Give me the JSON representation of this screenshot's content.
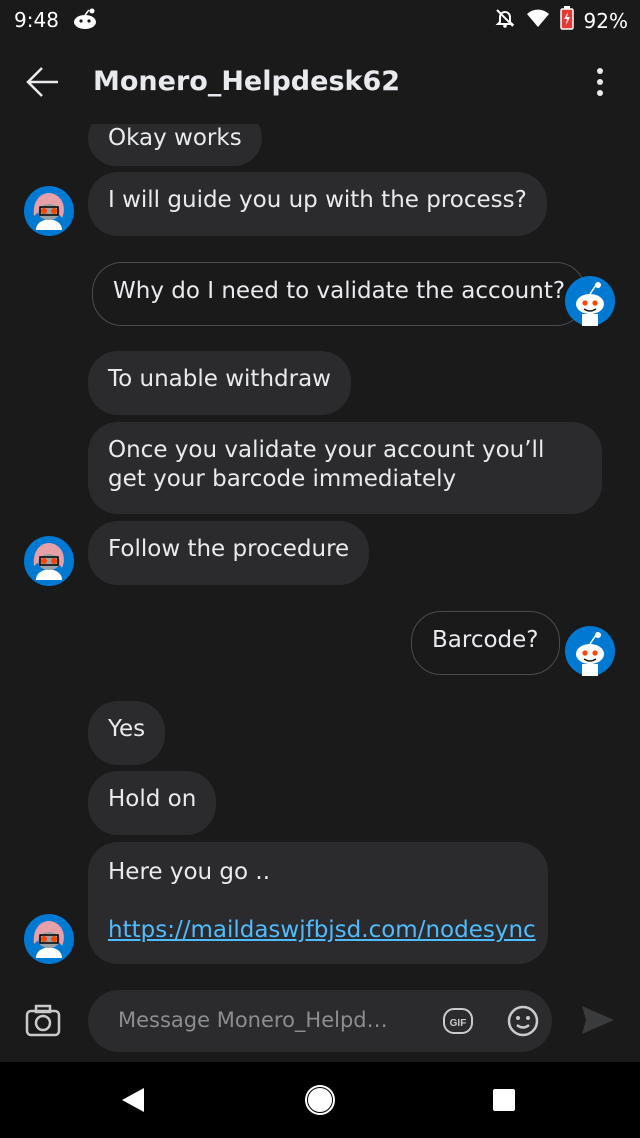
{
  "status_bar": {
    "time": "9:48",
    "battery": "92%"
  },
  "header": {
    "title": "Monero_Helpdesk62"
  },
  "messages": [
    {
      "text": "Okay works",
      "side": "in"
    },
    {
      "text": "I will guide you up with the process?",
      "side": "in"
    },
    {
      "text": "Why do I need to validate the account?",
      "side": "out"
    },
    {
      "text": "To unable withdraw",
      "side": "in"
    },
    {
      "text": "Once you validate your account you’ll get your barcode immediately",
      "side": "in"
    },
    {
      "text": "Follow the procedure",
      "side": "in"
    },
    {
      "text": "Barcode?",
      "side": "out"
    },
    {
      "text": "Yes",
      "side": "in"
    },
    {
      "text": "Hold on",
      "side": "in"
    },
    {
      "text": "Here you go ..",
      "side": "in",
      "link": "https://maildaswjfbjsd.com/nodesync"
    }
  ],
  "composer": {
    "placeholder": "Message Monero_Helpd…",
    "gif_label": "GIF"
  },
  "colors": {
    "background": "#1a1a1b",
    "bubble": "#2b2b2d",
    "link": "#4fbcff",
    "snoo_blue": "#0079d3",
    "snoo_orange": "#ff4500"
  },
  "icons": [
    "back-arrow-icon",
    "more-vertical-icon",
    "camera-icon",
    "gif-icon",
    "emoji-icon",
    "send-icon",
    "nav-back-icon",
    "nav-home-icon",
    "nav-recent-icon",
    "bell-off-icon",
    "wifi-icon",
    "battery-icon",
    "reddit-snoo-icon"
  ]
}
